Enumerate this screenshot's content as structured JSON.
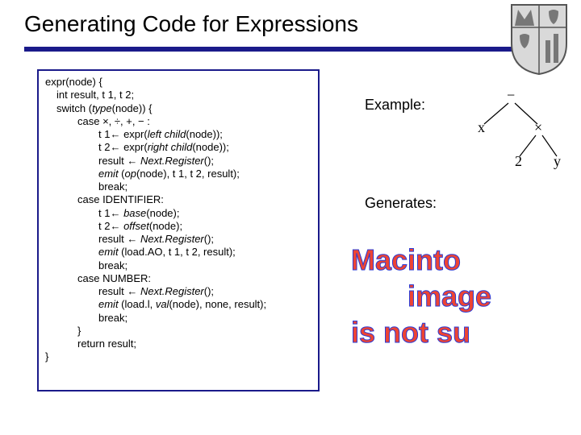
{
  "title": "Generating Code for Expressions",
  "code": {
    "l0": "expr(node) {",
    "l1": "int result, t 1, t 2;",
    "l2a": "switch (",
    "l2b": "type",
    "l2c": "(node)) {",
    "l3": "case ×, ÷, +, − :",
    "l4a": "t 1← expr(",
    "l4b": "left child",
    "l4c": "(node));",
    "l5a": "t 2← expr(",
    "l5b": "right child",
    "l5c": "(node));",
    "l6a": "result ← ",
    "l6b": "Next.Register",
    "l6c": "();",
    "l7a": "emit",
    "l7b": " (",
    "l7c": "op",
    "l7d": "(node), t 1, t 2, result);",
    "l8": "break;",
    "l9": "case IDENTIFIER:",
    "l10a": "t 1← ",
    "l10b": "base",
    "l10c": "(node);",
    "l11a": "t 2← ",
    "l11b": "offset",
    "l11c": "(node);",
    "l12a": "result ← ",
    "l12b": "Next.Register",
    "l12c": "();",
    "l13a": "emit",
    "l13b": " (load.AO, t 1, t 2, result);",
    "l14": "break;",
    "l15": "case NUMBER:",
    "l16a": "result ← ",
    "l16b": "Next.Register",
    "l16c": "();",
    "l17a": "emit",
    "l17b": " (load.l, ",
    "l17c": "val",
    "l17d": "(node), none, result);",
    "l18": "break;",
    "l19": "}",
    "l20": "return result;",
    "l21": "}"
  },
  "labels": {
    "example": "Example:",
    "generates": "Generates:"
  },
  "tree": {
    "root": "−",
    "left": "x",
    "right": "×",
    "rl": "2",
    "rr": "y"
  },
  "watermark": {
    "line1": "Macinto",
    "line2": "       image",
    "line3": "is not su"
  }
}
